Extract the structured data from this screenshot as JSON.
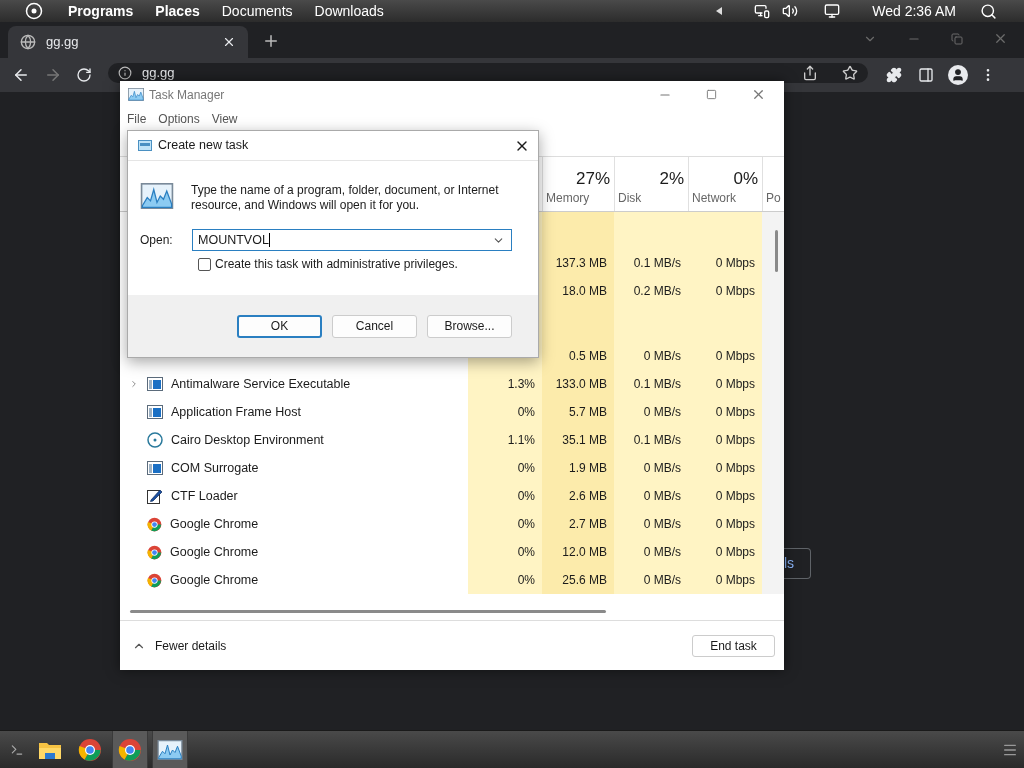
{
  "top_bar": {
    "menu": [
      {
        "label": "Programs",
        "bold": true
      },
      {
        "label": "Places",
        "bold": true
      },
      {
        "label": "Documents",
        "bold": false
      },
      {
        "label": "Downloads",
        "bold": false
      }
    ],
    "clock": "Wed 2:36 AM"
  },
  "browser": {
    "tab": {
      "title": "gg.gg"
    },
    "address": "gg.gg",
    "page_button": "ls"
  },
  "task_manager": {
    "title": "Task Manager",
    "menu": [
      "File",
      "Options",
      "View"
    ],
    "columns": [
      {
        "percent": "27%",
        "label": "Memory"
      },
      {
        "percent": "2%",
        "label": "Disk"
      },
      {
        "percent": "0%",
        "label": "Network"
      },
      {
        "label": "Po"
      }
    ],
    "rows": [
      {
        "kind": "group"
      },
      {
        "kind": "hidden",
        "memory": "137.3 MB",
        "disk": "0.1 MB/s",
        "network": "0 Mbps"
      },
      {
        "kind": "hidden",
        "memory": "18.0 MB",
        "disk": "0.2 MB/s",
        "network": "0 Mbps"
      },
      {
        "kind": "group"
      },
      {
        "kind": "hidden",
        "memory": "0.5 MB",
        "disk": "0 MB/s",
        "network": "0 Mbps"
      },
      {
        "kind": "app",
        "name": "Antimalware Service Executable",
        "expandable": true,
        "cpu": "1.3%",
        "memory": "133.0 MB",
        "disk": "0.1 MB/s",
        "network": "0 Mbps"
      },
      {
        "kind": "app",
        "name": "Application Frame Host",
        "expandable": false,
        "cpu": "0%",
        "memory": "5.7 MB",
        "disk": "0 MB/s",
        "network": "0 Mbps"
      },
      {
        "kind": "ring",
        "name": "Cairo Desktop Environment",
        "expandable": false,
        "cpu": "1.1%",
        "memory": "35.1 MB",
        "disk": "0.1 MB/s",
        "network": "0 Mbps"
      },
      {
        "kind": "app",
        "name": "COM Surrogate",
        "expandable": false,
        "cpu": "0%",
        "memory": "1.9 MB",
        "disk": "0 MB/s",
        "network": "0 Mbps"
      },
      {
        "kind": "pen",
        "name": "CTF Loader",
        "expandable": false,
        "cpu": "0%",
        "memory": "2.6 MB",
        "disk": "0 MB/s",
        "network": "0 Mbps"
      },
      {
        "kind": "chrome",
        "name": "Google Chrome",
        "expandable": false,
        "cpu": "0%",
        "memory": "2.7 MB",
        "disk": "0 MB/s",
        "network": "0 Mbps"
      },
      {
        "kind": "chrome",
        "name": "Google Chrome",
        "expandable": false,
        "cpu": "0%",
        "memory": "12.0 MB",
        "disk": "0 MB/s",
        "network": "0 Mbps"
      },
      {
        "kind": "chrome",
        "name": "Google Chrome",
        "expandable": false,
        "cpu": "0%",
        "memory": "25.6 MB",
        "disk": "0 MB/s",
        "network": "0 Mbps"
      }
    ],
    "footer": {
      "toggle": "Fewer details",
      "button": "End task"
    }
  },
  "dialog": {
    "title": "Create new task",
    "message": "Type the name of a program, folder, document, or Internet resource, and Windows will open it for you.",
    "open_label": "Open:",
    "open_value": "MOUNTVOL",
    "admin": {
      "label": "Create this task with administrative privileges.",
      "checked": false
    },
    "buttons": [
      {
        "label": "OK",
        "selected": true
      },
      {
        "label": "Cancel",
        "selected": false
      },
      {
        "label": "Browse...",
        "selected": false
      }
    ]
  },
  "taskbar": {
    "items": [
      {
        "kind": "terminal",
        "active": false
      },
      {
        "kind": "folder",
        "active": false
      },
      {
        "kind": "chrome",
        "active": false
      },
      {
        "kind": "chrome",
        "active": true
      },
      {
        "kind": "taskmgr",
        "active": true
      }
    ]
  }
}
